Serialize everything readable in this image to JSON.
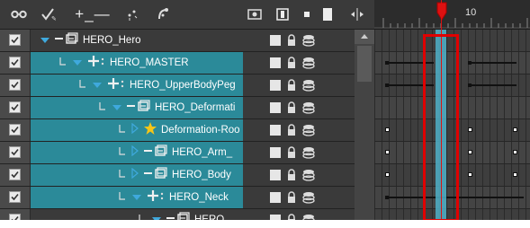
{
  "toolbar": {
    "icons": [
      "glasses-icon",
      "add-layer-icon",
      "add-remove-icon",
      "peg-icon",
      "deform-icon",
      "camera-icon",
      "square-view-icon",
      "square-small-icon",
      "rect-view-icon",
      "expand-icon"
    ],
    "add_remove_label": "+_—"
  },
  "ruler": {
    "frame_label": "10"
  },
  "layers": [
    {
      "name": "HERO_Hero",
      "indent": 0,
      "type": "drawing",
      "expanded": true,
      "selected": false,
      "checked": true
    },
    {
      "name": "HERO_MASTER",
      "indent": 1,
      "type": "peg",
      "expanded": true,
      "selected": true,
      "checked": true
    },
    {
      "name": "HERO_UpperBodyPeg",
      "indent": 2,
      "type": "peg",
      "expanded": true,
      "selected": true,
      "checked": true
    },
    {
      "name": "HERO_Deformati",
      "indent": 3,
      "type": "drawing",
      "expanded": true,
      "selected": true,
      "checked": true
    },
    {
      "name": "Deformation-Roo",
      "indent": 4,
      "type": "deformation",
      "expanded": false,
      "selected": true,
      "checked": true
    },
    {
      "name": "HERO_Arm_",
      "indent": 4,
      "type": "drawing",
      "expanded": false,
      "selected": true,
      "checked": true
    },
    {
      "name": "HERO_Body",
      "indent": 4,
      "type": "drawing",
      "expanded": false,
      "selected": true,
      "checked": true
    },
    {
      "name": "HERO_Neck",
      "indent": 4,
      "type": "peg",
      "expanded": true,
      "selected": true,
      "checked": true
    },
    {
      "name": "HERO",
      "indent": 5,
      "type": "drawing",
      "expanded": true,
      "selected": false,
      "checked": true
    }
  ],
  "colors": {
    "selection": "#2b8a99",
    "playhead": "#dd1111",
    "highlight": "#e00000"
  }
}
